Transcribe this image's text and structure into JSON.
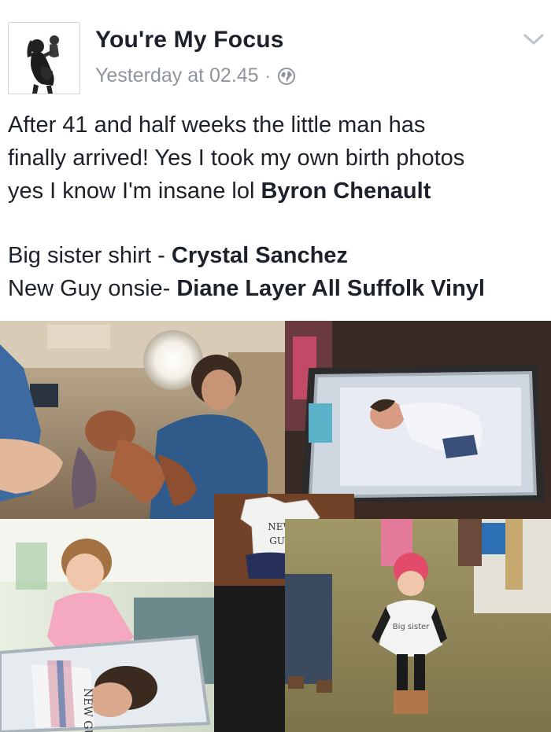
{
  "post": {
    "page_name": "You're My Focus",
    "timestamp": "Yesterday at 02.45",
    "separator": "·",
    "privacy_icon": "globe-icon",
    "menu_icon": "chevron-down-icon",
    "text": {
      "line1": "After 41 and half weeks the little man has",
      "line2": "finally arrived! Yes I took my own birth photos",
      "line3_plain": "yes I know I'm insane lol ",
      "line3_tag": "Byron Chenault",
      "line4_plain": "Big sister shirt - ",
      "line4_tag": "Crystal Sanchez",
      "line5_plain": "New Guy onsie- ",
      "line5_tag": "Diane Layer All Suffolk Vinyl"
    }
  },
  "photos": {
    "onesie_text_line1": "NEW",
    "onesie_text_line2": "GUY",
    "shirt_text": "Big sister",
    "blanket_text": "NEW GUY"
  },
  "colors": {
    "text": "#1d2129",
    "meta": "#90949c",
    "accent_pink": "#e34b6a"
  }
}
